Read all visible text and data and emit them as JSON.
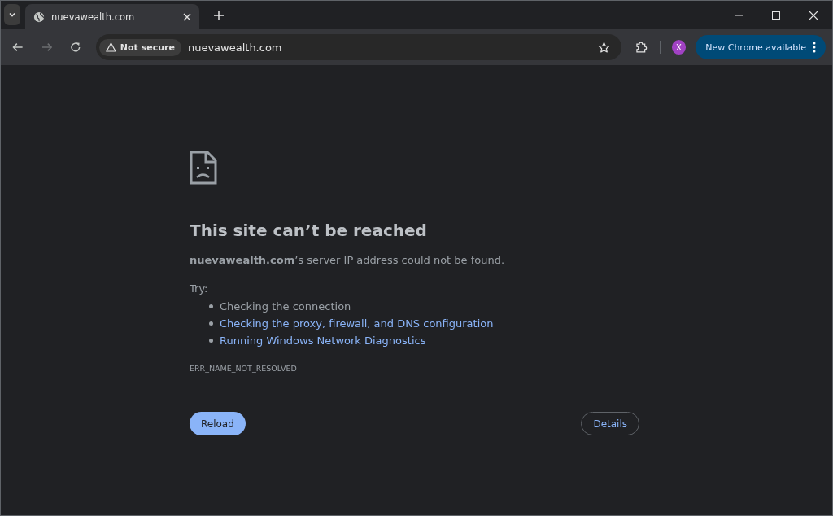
{
  "tabs": [
    {
      "title": "nuevawealth.com",
      "selected": true
    }
  ],
  "toolbar": {
    "security_label": "Not secure",
    "url": "nuevawealth.com",
    "avatar": "X",
    "update_button": "New Chrome available"
  },
  "page": {
    "heading": "This site can’t be reached",
    "message": "**nuevawealth.com**’s server IP address could not be found.",
    "try_label": "Try:",
    "suggestions": [
      {
        "text": "Checking the connection",
        "kind": "text"
      },
      {
        "text": "Checking the proxy, firewall, and DNS configuration",
        "kind": "link"
      },
      {
        "text": "Running Windows Network Diagnostics",
        "kind": "link"
      }
    ],
    "error_code": "ERR_NAME_NOT_RESOLVED",
    "reload_button": "Reload",
    "details_button": "Details"
  }
}
